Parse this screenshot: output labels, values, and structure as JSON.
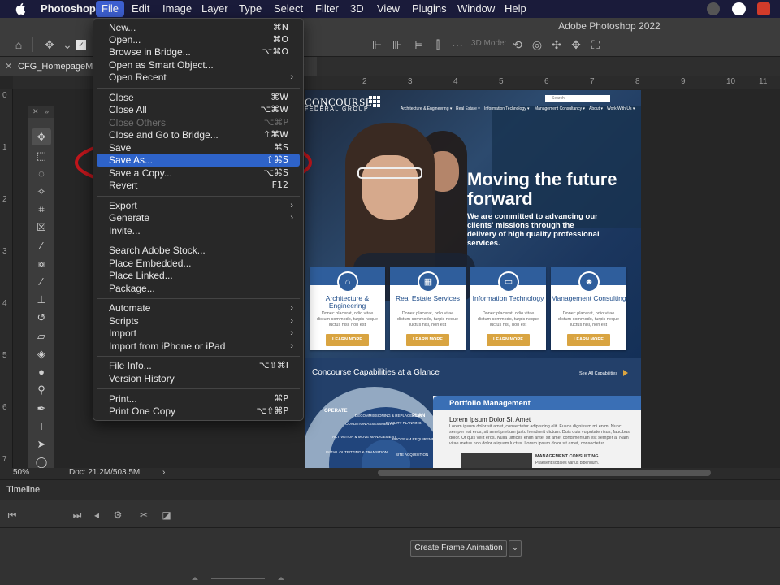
{
  "menubar": {
    "app_name": "Photoshop",
    "items": [
      "File",
      "Edit",
      "Image",
      "Layer",
      "Type",
      "Select",
      "Filter",
      "3D",
      "View",
      "Plugins",
      "Window",
      "Help"
    ],
    "active_item": "File"
  },
  "window": {
    "title": "Adobe Photoshop 2022"
  },
  "options": {
    "mode_label": "3D Mode:"
  },
  "tab": {
    "name": "CFG_HomepageMoc",
    "suffix": "* "
  },
  "ruler": {
    "top_labels": [
      "2",
      "3",
      "4",
      "5",
      "6",
      "7",
      "8",
      "9",
      "10",
      "11"
    ],
    "left_labels": [
      "0",
      "1",
      "2",
      "3",
      "4",
      "5",
      "6",
      "7"
    ]
  },
  "file_menu": {
    "groups": [
      [
        {
          "label": "New...",
          "shortcut": "⌘N"
        },
        {
          "label": "Open...",
          "shortcut": "⌘O"
        },
        {
          "label": "Browse in Bridge...",
          "shortcut": "⌥⌘O"
        },
        {
          "label": "Open as Smart Object...",
          "shortcut": ""
        },
        {
          "label": "Open Recent",
          "submenu": true
        }
      ],
      [
        {
          "label": "Close",
          "shortcut": "⌘W"
        },
        {
          "label": "Close All",
          "shortcut": "⌥⌘W"
        },
        {
          "label": "Close Others",
          "shortcut": "⌥⌘P",
          "disabled": true
        },
        {
          "label": "Close and Go to Bridge...",
          "shortcut": "⇧⌘W"
        },
        {
          "label": "Save",
          "shortcut": "⌘S"
        },
        {
          "label": "Save As...",
          "shortcut": "⇧⌘S",
          "highlighted": true
        },
        {
          "label": "Save a Copy...",
          "shortcut": "⌥⌘S"
        },
        {
          "label": "Revert",
          "shortcut": "F12"
        }
      ],
      [
        {
          "label": "Export",
          "submenu": true
        },
        {
          "label": "Generate",
          "submenu": true
        },
        {
          "label": "Invite...",
          "shortcut": ""
        }
      ],
      [
        {
          "label": "Search Adobe Stock...",
          "shortcut": ""
        },
        {
          "label": "Place Embedded...",
          "shortcut": ""
        },
        {
          "label": "Place Linked...",
          "shortcut": ""
        },
        {
          "label": "Package...",
          "shortcut": ""
        }
      ],
      [
        {
          "label": "Automate",
          "submenu": true
        },
        {
          "label": "Scripts",
          "submenu": true
        },
        {
          "label": "Import",
          "submenu": true
        },
        {
          "label": "Import from iPhone or iPad",
          "submenu": true
        }
      ],
      [
        {
          "label": "File Info...",
          "shortcut": "⌥⇧⌘I"
        },
        {
          "label": "Version History",
          "shortcut": ""
        }
      ],
      [
        {
          "label": "Print...",
          "shortcut": "⌘P"
        },
        {
          "label": "Print One Copy",
          "shortcut": "⌥⇧⌘P"
        }
      ]
    ]
  },
  "status": {
    "zoom": "50%",
    "doc_size": "Doc: 21.2M/503.5M"
  },
  "timeline": {
    "title": "Timeline",
    "create_button": "Create Frame Animation"
  },
  "colors": {
    "foreground": "#7a1414",
    "background": "#ffffff",
    "annotation": "#c0161c",
    "menu_highlight": "#2e63c9"
  },
  "document": {
    "logo_main": "CONCOURSE",
    "logo_sub": "FEDERAL GROUP",
    "search_placeholder": "Search",
    "nav": [
      "Architecture & Engineering ▾",
      "Real Estate ▾",
      "Information Technology ▾",
      "Management Consultancy ▾",
      "About ▾",
      "Work With Us ▾"
    ],
    "headline": "Moving the future forward",
    "subhead": "We are committed to advancing our clients' missions through the delivery of high quality professional services.",
    "services": [
      {
        "title": "Architecture & Engineering",
        "body": "Donec placerat, odio vitae dictum commodo, turpis neque luctus nisi, non est",
        "button": "LEARN MORE"
      },
      {
        "title": "Real Estate Services",
        "body": "Donec placerat, odio vitae dictum commodo, turpis neque luctus nisi, non est",
        "button": "LEARN MORE"
      },
      {
        "title": "Information Technology",
        "body": "Donec placerat, odio vitae dictum commodo, turpis neque luctus nisi, non est",
        "button": "LEARN MORE"
      },
      {
        "title": "Management Consulting",
        "body": "Donec placerat, odio vitae dictum commodo, turpis neque luctus nisi, non est",
        "button": "LEARN MORE"
      }
    ],
    "capabilities_title": "Concourse Capabilities at a Glance",
    "capabilities_link": "See All Capabilities",
    "wheel": {
      "outer": [
        "OPERATE",
        "PLAN"
      ],
      "inner": [
        "DECOMMISSIONING & REPLACEMENT",
        "FACILITY PLANNING",
        "CONDITION ASSESSMENTS",
        "ACTIVATION & MOVE MANAGEMENT",
        "PROGRAM REQUIREMENTS",
        "INITIAL OUTFITTING & TRANSITION",
        "SITE ACQUISITION"
      ]
    },
    "portfolio": {
      "title": "Portfolio Management",
      "heading": "Lorem Ipsum Dolor Sit Amet",
      "body": "Lorem ipsum dolor sit amet, consectetur adipiscing elit. Fusce dignissim mi enim. Nunc semper est eros, sit amet pretium justo hendrerit dictum. Duis quis vulputate risus, faucibus dolor. Ut quis velit eros. Nulla ultrices enim ante, sit amet condimentum est semper a. Nam vitae metus non dolor aliquam luctus. Lorem ipsum dolor sit amet, consectetur.",
      "sub_title": "MANAGEMENT CONSULTING",
      "sub_body": "Praesent sodales varius bibendum."
    }
  }
}
